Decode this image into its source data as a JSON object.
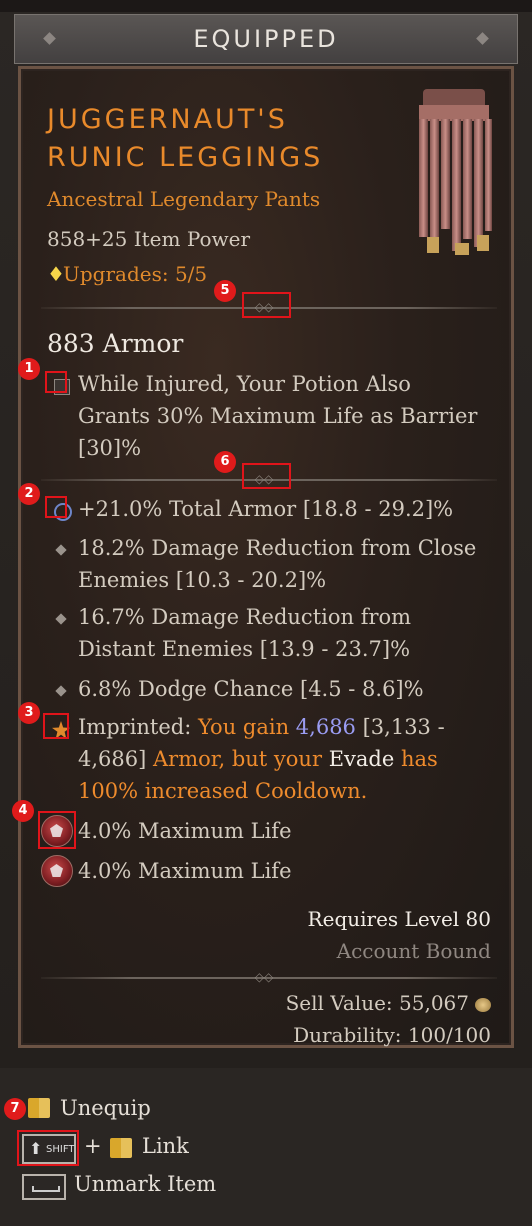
{
  "header": {
    "title": "EQUIPPED"
  },
  "item": {
    "name": "Juggernaut's Runic Leggings",
    "type": "Ancestral Legendary Pants",
    "power": "858+25 Item Power",
    "upgrades": "Upgrades: 5/5",
    "armor": "883 Armor",
    "implicit": "While Injured, Your Potion Also Grants 30% Maximum Life as Barrier [30]%",
    "affixes": [
      "+21.0% Total Armor [18.8 - 29.2]%",
      "18.2% Damage Reduction from Close Enemies [10.3 - 20.2]%",
      "16.7% Damage Reduction from Distant Enemies [13.9 - 23.7]%",
      "6.8% Dodge Chance [4.5 - 8.6]%"
    ],
    "imprinted": {
      "label": "Imprinted:",
      "part1": "You gain",
      "value": "4,686",
      "range": "[3,133 - 4,686]",
      "part2": "Armor, but your",
      "skill": "Evade",
      "part3": "has 100% increased Cooldown."
    },
    "sockets": [
      "4.0% Maximum Life",
      "4.0% Maximum Life"
    ],
    "requires": "Requires Level 80",
    "bound": "Account Bound",
    "sell_label": "Sell Value:",
    "sell_value": "55,067",
    "durability_label": "Durability:",
    "durability_value": "100/100"
  },
  "actions": {
    "unequip": "Unequip",
    "shift": "SHIFT",
    "plus": "+",
    "link": "Link",
    "unmark": "Unmark Item"
  },
  "annotations": [
    "1",
    "2",
    "3",
    "4",
    "5",
    "6",
    "7"
  ],
  "colors": {
    "legendary": "#e98a2b",
    "annotation": "#e01b1b",
    "blue_value": "#9a9cf2"
  }
}
